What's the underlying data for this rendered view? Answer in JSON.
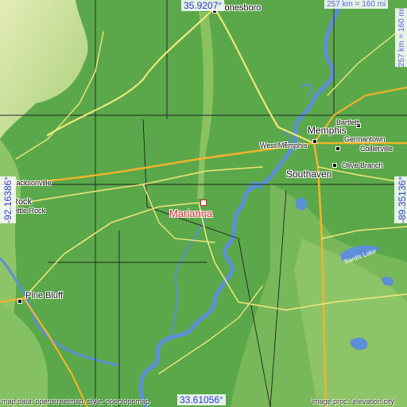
{
  "map": {
    "target": {
      "name": "Marianna"
    },
    "cities": [
      {
        "id": "jonesboro",
        "name": "Jonesboro"
      },
      {
        "id": "memphis",
        "name": "Memphis"
      },
      {
        "id": "west-memphis",
        "name": "West Memphis"
      },
      {
        "id": "southaven",
        "name": "Southaven"
      },
      {
        "id": "bartlett",
        "name": "Bartlett"
      },
      {
        "id": "germantown",
        "name": "Germantown"
      },
      {
        "id": "collierville",
        "name": "Collierville"
      },
      {
        "id": "olive-branch",
        "name": "Olive Branch"
      },
      {
        "id": "jacksonville",
        "name": "Jacksonville"
      },
      {
        "id": "rock",
        "name": "Rock"
      },
      {
        "id": "little-rock",
        "name": "Little Rock"
      },
      {
        "id": "pine-bluff",
        "name": "Pine Bluff"
      }
    ],
    "lakes": [
      {
        "id": "sardis-lake",
        "name": "Sardis Lake"
      }
    ],
    "coordinates": {
      "top": "35.9207°",
      "bottom": "33.61056°",
      "left": "-92.16386°",
      "right": "-89.35136°"
    },
    "scale": {
      "horizontal": "257 km = 160 mi",
      "vertical": "257 km = 160 mi"
    },
    "credits": {
      "left": "map data: openstreetmap, style: opentopomap",
      "right": "image proc.: elevation.city"
    },
    "colors": {
      "lowland": "#5aa84a",
      "upland": "#d8e6a8",
      "water": "#5b8fd8",
      "highway": "#f2b32a",
      "road": "#f0e678",
      "border": "#222222",
      "target": "#e0202a",
      "coord_text": "#2a3ad2"
    }
  }
}
